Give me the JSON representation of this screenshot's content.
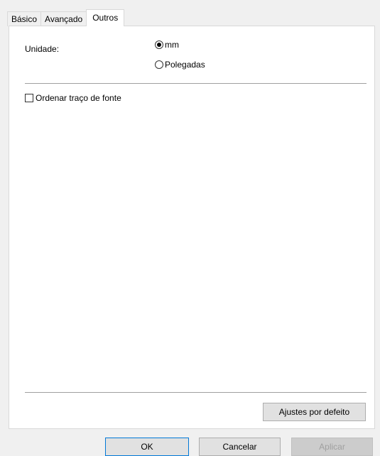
{
  "tabs": [
    "Básico",
    "Avançado",
    "Outros"
  ],
  "active_tab": "Outros",
  "unidade": {
    "label": "Unidade:",
    "options": [
      {
        "label": "mm",
        "selected": true
      },
      {
        "label": "Polegadas",
        "selected": false
      }
    ]
  },
  "ordenar": {
    "label": "Ordenar traço de fonte",
    "checked": false
  },
  "buttons": {
    "defaults": "Ajustes por defeito",
    "ok": "OK",
    "cancel": "Cancelar",
    "apply": "Aplicar"
  }
}
